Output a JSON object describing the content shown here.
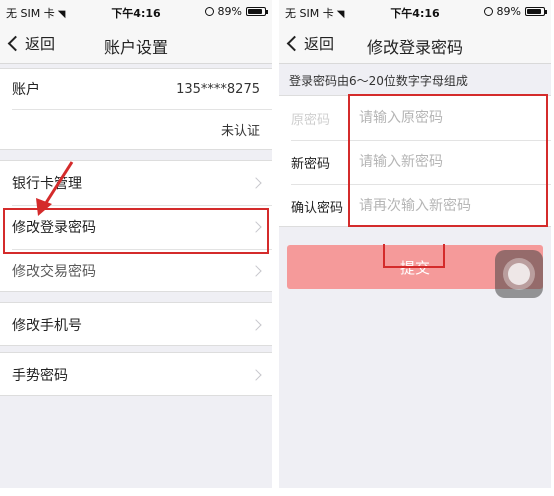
{
  "left": {
    "statusbar": {
      "carrier": "无 SIM 卡",
      "time": "下午4:16",
      "battery_text": "89%",
      "battery_level": 0.89
    },
    "navbar": {
      "back": "返回",
      "title": "账户设置"
    },
    "account": {
      "label": "账户",
      "value": "135****8275",
      "verify_status": "未认证"
    },
    "menu": [
      {
        "label": "银行卡管理"
      },
      {
        "label": "修改登录密码"
      },
      {
        "label": "修改交易密码"
      },
      {
        "label": "修改手机号"
      },
      {
        "label": "手势密码"
      }
    ]
  },
  "right": {
    "statusbar": {
      "carrier": "无 SIM 卡",
      "time": "下午4:16",
      "battery_text": "89%",
      "battery_level": 0.89
    },
    "navbar": {
      "back": "返回",
      "title": "修改登录密码"
    },
    "hint": "登录密码由6～20位数字字母组成",
    "form": {
      "old_label": "原密码",
      "old_placeholder": "请输入原密码",
      "new_label": "新密码",
      "new_placeholder": "请输入新密码",
      "confirm_label": "确认密码",
      "confirm_placeholder": "请再次输入新密码"
    },
    "submit": "提交"
  },
  "colors": {
    "highlight": "#d42b2b",
    "submit_bg": "#f59a9a",
    "background": "#efeff4"
  }
}
